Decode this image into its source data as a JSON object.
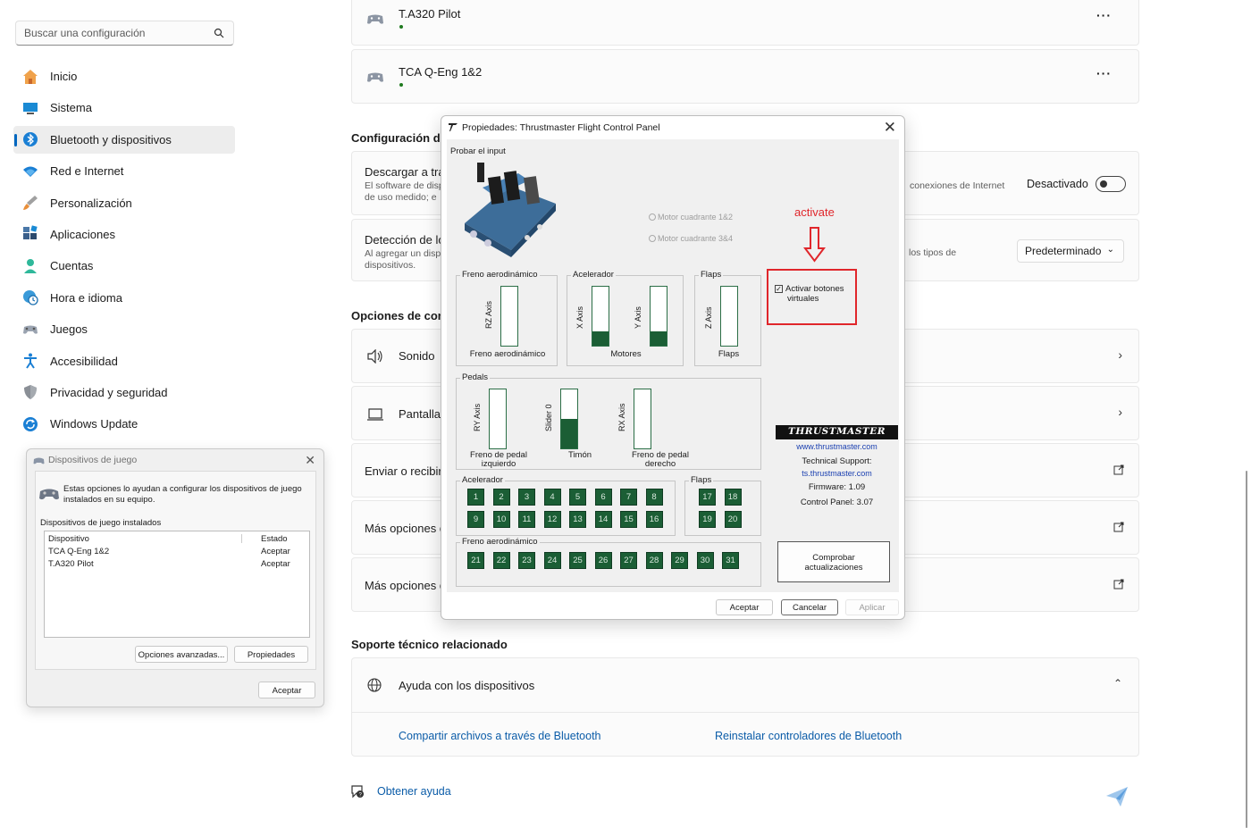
{
  "sidebar": {
    "search_placeholder": "Buscar una configuración",
    "items": [
      {
        "label": "Inicio",
        "icon": "home-icon"
      },
      {
        "label": "Sistema",
        "icon": "monitor-icon"
      },
      {
        "label": "Bluetooth y dispositivos",
        "icon": "bluetooth-icon"
      },
      {
        "label": "Red e Internet",
        "icon": "wifi-icon"
      },
      {
        "label": "Personalización",
        "icon": "brush-icon"
      },
      {
        "label": "Aplicaciones",
        "icon": "apps-icon"
      },
      {
        "label": "Cuentas",
        "icon": "person-icon"
      },
      {
        "label": "Hora e idioma",
        "icon": "globe-clock-icon"
      },
      {
        "label": "Juegos",
        "icon": "gamepad-icon"
      },
      {
        "label": "Accesibilidad",
        "icon": "accessibility-icon"
      },
      {
        "label": "Privacidad y seguridad",
        "icon": "shield-icon"
      },
      {
        "label": "Windows Update",
        "icon": "update-icon"
      }
    ],
    "active_index": 2
  },
  "devices": [
    {
      "name": "T.A320 Pilot"
    },
    {
      "name": "TCA Q-Eng 1&2"
    }
  ],
  "settings": {
    "section_title": "Configuración de",
    "download_title": "Descargar a trav",
    "download_sub_1": "El software de disp",
    "download_sub_2": "de uso medido; e",
    "download_right_text": "conexiones de Internet",
    "download_toggle_label": "Desactivado",
    "detect_title": "Detección de lo",
    "detect_sub_1": "Al agregar un disp",
    "detect_sub_2": "dispositivos.",
    "detect_right_text": "los tipos de",
    "detect_select_value": "Predeterminado"
  },
  "options": {
    "section_title": "Opciones de confi",
    "sound_label": "Sonido",
    "display_label": "Pantalla",
    "send_label": "Enviar o recibir",
    "more_label_1": "Más opciones d",
    "more_label_2": "Más opciones d"
  },
  "support": {
    "section_title": "Soporte técnico relacionado",
    "help_label": "Ayuda con los dispositivos",
    "link_1": "Compartir archivos a través de Bluetooth",
    "link_2": "Reinstalar controladores de Bluetooth",
    "get_help": "Obtener ayuda"
  },
  "game_dialog": {
    "title": "Dispositivos de juego",
    "desc": "Estas opciones lo ayudan a configurar los dispositivos de juego instalados en su equipo.",
    "installed_label": "Dispositivos de juego instalados",
    "col_device": "Dispositivo",
    "col_status": "Estado",
    "rows": [
      {
        "device": "TCA Q-Eng 1&2",
        "status": "Aceptar"
      },
      {
        "device": "T.A320 Pilot",
        "status": "Aceptar"
      }
    ],
    "btn_advanced": "Opciones avanzadas...",
    "btn_properties": "Propiedades",
    "btn_ok": "Aceptar"
  },
  "tm_dialog": {
    "title": "Propiedades: Thrustmaster Flight Control Panel",
    "test_input": "Probar el input",
    "radio_1": "Motor cuadrante 1&2",
    "radio_2": "Motor cuadrante 3&4",
    "grp_brake": "Freno aerodinámico",
    "brake_axis": "RZ Axis",
    "brake_cap": "Freno aerodinámico",
    "grp_throttle": "Acelerador",
    "x_axis": "X Axis",
    "y_axis": "Y Axis",
    "engines_cap": "Motores",
    "grp_flaps": "Flaps",
    "z_axis": "Z Axis",
    "flaps_cap": "Flaps",
    "grp_pedals": "Pedals",
    "ry_axis": "RY Axis",
    "slider_axis": "Slider 0",
    "rx_axis": "RX Axis",
    "left_pedal_1": "Freno de pedal",
    "left_pedal_2": "izquierdo",
    "rudder_cap": "Timón",
    "right_pedal_1": "Freno de pedal",
    "right_pedal_2": "derecho",
    "grp_buttons_throttle": "Acelerador",
    "grp_buttons_flaps": "Flaps",
    "grp_buttons_brake": "Freno aerodinámico",
    "virtual_buttons_1": "Activar botones",
    "virtual_buttons_2": "virtuales",
    "brand_logo": "THRUSTMASTER",
    "website": "www.thrustmaster.com",
    "support_label": "Technical Support:",
    "support_link": "ts.thrustmaster.com",
    "firmware": "Firmware:  1.09",
    "control_panel": "Control Panel: 3.07",
    "btn_check_1": "Comprobar",
    "btn_check_2": "actualizaciones",
    "btn_ok": "Aceptar",
    "btn_cancel": "Cancelar",
    "btn_apply": "Aplicar",
    "axis_levels": {
      "rz": 0,
      "x": 0.25,
      "y": 0.25,
      "z": 0,
      "ry": 0,
      "slider": 0.5,
      "rx": 0
    }
  },
  "annotation": {
    "text": "activate",
    "color": "#e0262b"
  },
  "colors": {
    "accent": "#0067c0",
    "button_green": "#1b5e35",
    "link": "#0b5ca8"
  }
}
